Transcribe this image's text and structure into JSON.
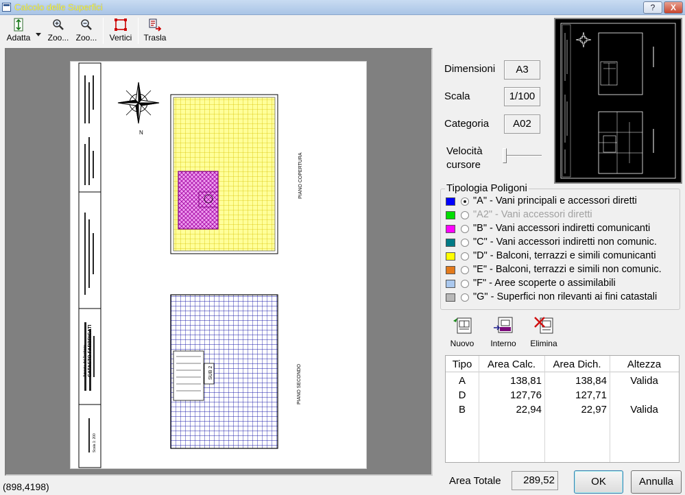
{
  "window": {
    "title": "Calcolo delle Superfici",
    "help_label": "?",
    "close_label": "X"
  },
  "toolbar": {
    "items": [
      {
        "label": "Adatta",
        "icon": "fit-vertical-icon"
      },
      {
        "label": "Zoo...",
        "icon": "zoom-in-icon"
      },
      {
        "label": "Zoo...",
        "icon": "zoom-out-icon"
      },
      {
        "label": "Vertici",
        "icon": "vertices-icon"
      },
      {
        "label": "Trasla",
        "icon": "move-icon"
      }
    ]
  },
  "status": {
    "coords": "(898,4198)"
  },
  "drawing": {
    "top_plan_label": "PIANO COPERTURA",
    "bottom_plan_label": "PIANO SECONDO",
    "north_label": "N",
    "stair_label": "SUB 2",
    "title_block": {
      "office": "Agenzia del Territorio",
      "heading": "CATASTO FABBRICATI",
      "sheet_label": "Scala 1: 200"
    }
  },
  "fields": {
    "dimensioni": {
      "label": "Dimensioni",
      "value": "A3"
    },
    "scala": {
      "label": "Scala",
      "value": "1/100"
    },
    "categoria": {
      "label": "Categoria",
      "value": "A02"
    },
    "velocita": {
      "label_line1": "Velocità",
      "label_line2": "cursore",
      "level": 0
    }
  },
  "tipologia": {
    "title": "Tipologia Poligoni",
    "items": [
      {
        "text": "\"A\" - Vani principali e accessori diretti",
        "color": "#0000ff",
        "selected": true,
        "enabled": true
      },
      {
        "text": "\"A2\" - Vani accessori diretti",
        "color": "#00dd00",
        "selected": false,
        "enabled": false
      },
      {
        "text": "\"B\" - Vani accessori indiretti comunicanti",
        "color": "#ff00ff",
        "selected": false,
        "enabled": true
      },
      {
        "text": "\"C\" - Vani accessori indiretti non comunic.",
        "color": "#007b86",
        "selected": false,
        "enabled": true
      },
      {
        "text": "\"D\" - Balconi, terrazzi e simili comunicanti",
        "color": "#ffff00",
        "selected": false,
        "enabled": true
      },
      {
        "text": "\"E\" - Balconi, terrazzi e simili non comunic.",
        "color": "#e37a1c",
        "selected": false,
        "enabled": true
      },
      {
        "text": "\"F\" - Aree scoperte o assimilabili",
        "color": "#aac8ee",
        "selected": false,
        "enabled": true
      },
      {
        "text": "\"G\" - Superfici non rilevanti ai fini catastali",
        "color": "#b8b8b8",
        "selected": false,
        "enabled": true
      }
    ]
  },
  "actions": {
    "nuovo": "Nuovo",
    "interno": "Interno",
    "elimina": "Elimina"
  },
  "table": {
    "columns": [
      "Tipo",
      "Area Calc.",
      "Area Dich.",
      "Altezza"
    ],
    "rows": [
      [
        "A",
        "138,81",
        "138,84",
        "Valida"
      ],
      [
        "D",
        "127,76",
        "127,71",
        ""
      ],
      [
        "B",
        "22,94",
        "22,97",
        "Valida"
      ]
    ]
  },
  "totals": {
    "label": "Area Totale",
    "value": "289,52"
  },
  "buttons": {
    "ok": "OK",
    "cancel": "Annulla"
  }
}
